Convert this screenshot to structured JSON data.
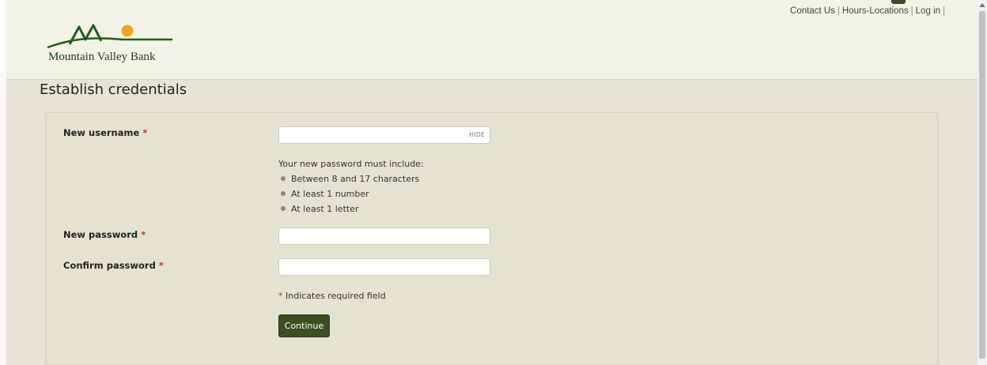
{
  "header": {
    "links": [
      "Contact Us",
      "Hours-Locations",
      "Log in"
    ],
    "logo_text": "Mountain Valley Bank"
  },
  "page": {
    "title": "Establish credentials"
  },
  "form": {
    "username_label": "New username",
    "required_mark": "*",
    "username_value": "",
    "hide_label": "HIDE",
    "rules_title": "Your new password must include:",
    "rules": [
      "Between 8 and 17 characters",
      "At least 1 number",
      "At least 1 letter"
    ],
    "password_label": "New password",
    "confirm_label": "Confirm password",
    "required_note": "Indicates required field",
    "continue_label": "Continue"
  },
  "colors": {
    "brand_green": "#3b4f22",
    "logo_sun": "#f0a81e",
    "required": "#c0392b"
  },
  "icons": [
    "mountain-logo-icon",
    "sun-icon",
    "bullet-icon",
    "scroll-up-icon"
  ]
}
